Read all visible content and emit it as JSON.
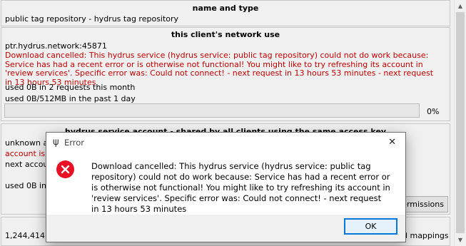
{
  "panel_name_type": {
    "title": "name and type",
    "text": "public tag repository - hydrus tag repository"
  },
  "panel_network": {
    "title": "this client's network use",
    "address": "ptr.hydrus.network:45871",
    "error_text": "Download cancelled: This hydrus service (hydrus service: public tag repository) could not do work because: Service has had a recent error or is otherwise not functional! You might like to try refreshing its account in 'review services'. Specific error was: Could not connect! - next request in 13 hours 53 minutes - next request in 13 hours 53 minutes",
    "usage_month": "used 0B in 2 requests this month",
    "usage_day": "used 0B/512MB in the past 1 day",
    "progress_label": "0%",
    "progress_value": 0
  },
  "panel_account": {
    "title": "hydrus service account - shared by all clients using the same access key",
    "line1": "unknown acc",
    "line2": "account is ur",
    "line3": "next accoun",
    "line4": "used 0B in 5",
    "permissions_button": "permissions"
  },
  "panel_bottom": {
    "line": "1,244,414,4",
    "right_text": "d mappings"
  },
  "dialog": {
    "title": "Error",
    "message": "Download cancelled: This hydrus service (hydrus service: public tag repository) could not do work because: Service has had a recent error or is otherwise not functional! You might like to try refreshing its account in 'review services'. Specific error was: Could not connect! - next request in 13 hours 53 minutes",
    "ok_label": "OK",
    "close_glyph": "✕",
    "app_glyph": "ψ"
  },
  "colors": {
    "error_text": "#c00000",
    "error_icon": "#e81123",
    "ok_border": "#0078d7"
  }
}
